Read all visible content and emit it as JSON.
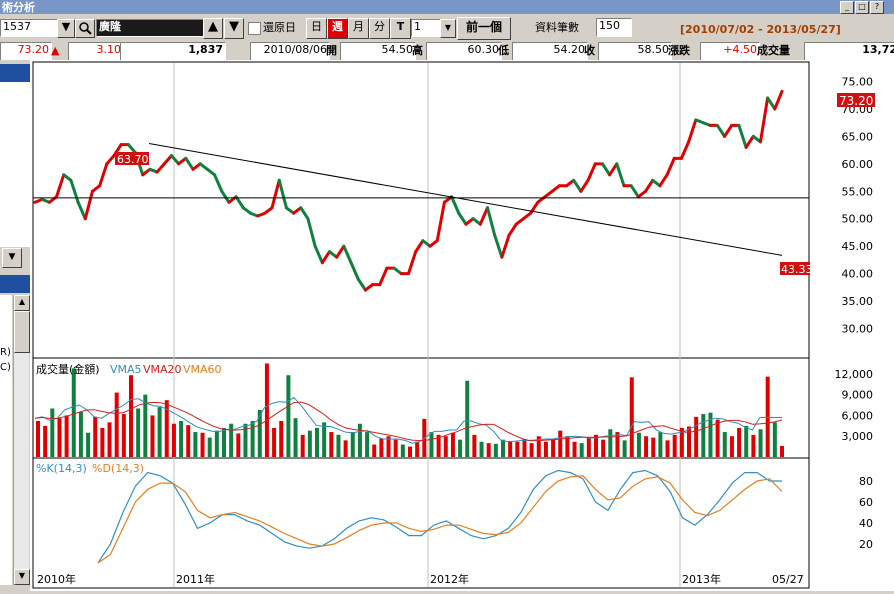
{
  "window": {
    "title": "術分析"
  },
  "toolbar": {
    "symbol_code": "1537",
    "symbol_name": "廣隆",
    "restore_label": "還原日",
    "period_day": "日",
    "period_week": "週",
    "period_month": "月",
    "period_minute": "分",
    "period_tick": "T",
    "multiplier": "1",
    "prev_label": "前一個",
    "records_label": "資料筆數",
    "records_value": "150",
    "date_range": "[2010/07/02 - 2013/05/27]"
  },
  "quote": {
    "last": "73.20",
    "change": "3.10",
    "volume_summary": "1,837",
    "date": "2010/08/06",
    "open_label": "開",
    "open": "54.50",
    "high_label": "高",
    "high": "60.30",
    "low_label": "低",
    "low": "54.20",
    "close_label": "收",
    "close": "58.50",
    "chg_label": "漲跌",
    "chg": "+4.50",
    "vol_label": "成交量",
    "vol": "13,72"
  },
  "colors": {
    "up": "#e00000",
    "down": "#108040",
    "vma5": "#2f8fb8",
    "vma20": "#d02020",
    "vma60": "#e08020",
    "k": "#3090c0",
    "d": "#e08020"
  },
  "left_panel": {
    "label_r": "R)",
    "label_c": "C)"
  },
  "chart_data": [
    {
      "type": "line",
      "name": "price",
      "x_labels": [
        "2010年",
        "2011年",
        "2012年",
        "2013年",
        "05/27"
      ],
      "ylim": [
        25,
        78
      ],
      "yticks": [
        "75.00",
        "70.00",
        "65.00",
        "60.00",
        "55.00",
        "50.00",
        "45.00",
        "40.00",
        "35.00",
        "30.00"
      ],
      "last_price_label": "73.20",
      "annotations": [
        "63.70",
        "43.33"
      ],
      "trendline": {
        "start": 63.7,
        "end": 43.33
      },
      "support_level": 53.8,
      "values": [
        53,
        53.5,
        53,
        54,
        58,
        57,
        53,
        50,
        55,
        56,
        60,
        61.5,
        63.5,
        63.5,
        62,
        58,
        59,
        58.5,
        60,
        61.5,
        60,
        61,
        59,
        60,
        59,
        58,
        55,
        53,
        54,
        52,
        51,
        50.5,
        51,
        52,
        57,
        52,
        51,
        52,
        50,
        45,
        42,
        44,
        43,
        45,
        42,
        39,
        37,
        38,
        38,
        41,
        41,
        40,
        40,
        44,
        46,
        45,
        46,
        53,
        54,
        51,
        49,
        50,
        49,
        52,
        47,
        43,
        47,
        49,
        50,
        51,
        53,
        54,
        55,
        56,
        56,
        57,
        55,
        57,
        60,
        60,
        58,
        60,
        56,
        56,
        54,
        55,
        57,
        56,
        58,
        61,
        61,
        64,
        68,
        67.5,
        67,
        67,
        65,
        67,
        67,
        63,
        65,
        64,
        72,
        70,
        73.2
      ]
    },
    {
      "type": "bar",
      "name": "volume",
      "legend": [
        "成交量(金額)",
        "VMA5",
        "VMA20",
        "VMA60"
      ],
      "yticks": [
        "12,000",
        "9,000",
        "6,000",
        "3,000"
      ],
      "ylim": [
        0,
        14000
      ],
      "values": [
        5200,
        4500,
        7000,
        5600,
        6000,
        12800,
        6500,
        3500,
        5800,
        4200,
        5000,
        9300,
        6200,
        11800,
        7000,
        9000,
        6000,
        7200,
        8200,
        4800,
        5200,
        4600,
        3600,
        3500,
        2800,
        3800,
        4200,
        4800,
        3400,
        4800,
        5200,
        6800,
        13500,
        4200,
        5200,
        11800,
        5600,
        3200,
        3800,
        4200,
        5000,
        3600,
        3200,
        2400,
        3600,
        4800,
        3600,
        1800,
        2700,
        3000,
        2500,
        1800,
        1500,
        2200,
        5500,
        3600,
        3200,
        3000,
        3500,
        2500,
        11000,
        3200,
        2200,
        2000,
        1900,
        2500,
        2300,
        2200,
        2600,
        2000,
        3000,
        2200,
        2500,
        3800,
        3000,
        2200,
        2000,
        2800,
        3200,
        2500,
        4000,
        3600,
        2400,
        11500,
        3500,
        3000,
        2800,
        3600,
        2400,
        3200,
        4200,
        4400,
        5800,
        6200,
        6400,
        5400,
        3600,
        3000,
        4200,
        4500,
        3200,
        4000,
        11600,
        5000,
        1600
      ],
      "vma5_values": [
        5600,
        5800,
        5300,
        5600,
        6800,
        7200,
        7500,
        6800,
        5800,
        5600,
        6300,
        6900,
        7500,
        8300,
        8400,
        7800,
        7400,
        7300,
        6800,
        6200,
        5600,
        4900,
        4300,
        4000,
        3700,
        3700,
        4000,
        4000,
        4400,
        4600,
        5200,
        7100,
        7700,
        8000,
        7900,
        8600,
        7400,
        6000,
        4600,
        4400,
        4400,
        4000,
        3600,
        3500,
        3700,
        3800,
        3000,
        2600,
        2600,
        2600,
        2400,
        2000,
        2200,
        3000,
        3700,
        3700,
        3900,
        3900,
        5200,
        5200,
        4800,
        4600,
        3700,
        2400,
        2200,
        2300,
        2400,
        2400,
        2500,
        2600,
        2600,
        2800,
        2900,
        3000,
        2900,
        2700,
        2800,
        3000,
        3100,
        3200,
        3100,
        5100,
        5000,
        5100,
        3900,
        3400,
        3300,
        3500,
        3800,
        4300,
        4900,
        5300,
        5600,
        5500,
        5100,
        4900,
        4300,
        3900,
        5700,
        5700,
        5700,
        5700
      ]
    },
    {
      "type": "line",
      "name": "stochastic",
      "legend": [
        "%K(14,3)",
        "%D(14,3)"
      ],
      "yticks": [
        "80",
        "60",
        "40",
        "20"
      ],
      "ylim": [
        0,
        100
      ],
      "k_values": [
        2,
        20,
        50,
        75,
        88,
        85,
        78,
        58,
        35,
        40,
        48,
        48,
        42,
        38,
        30,
        22,
        18,
        16,
        18,
        25,
        35,
        42,
        45,
        43,
        36,
        28,
        28,
        38,
        42,
        35,
        28,
        25,
        28,
        35,
        50,
        72,
        85,
        90,
        88,
        82,
        60,
        52,
        72,
        88,
        90,
        85,
        70,
        45,
        38,
        48,
        62,
        78,
        88,
        88,
        80,
        80
      ],
      "d_values": [
        2,
        10,
        35,
        60,
        72,
        78,
        78,
        70,
        52,
        45,
        48,
        50,
        46,
        42,
        36,
        30,
        25,
        20,
        18,
        20,
        26,
        33,
        38,
        40,
        40,
        35,
        32,
        34,
        38,
        38,
        34,
        30,
        29,
        31,
        40,
        55,
        70,
        80,
        84,
        85,
        72,
        62,
        64,
        75,
        82,
        84,
        78,
        62,
        50,
        47,
        52,
        62,
        72,
        80,
        82,
        70
      ]
    }
  ]
}
